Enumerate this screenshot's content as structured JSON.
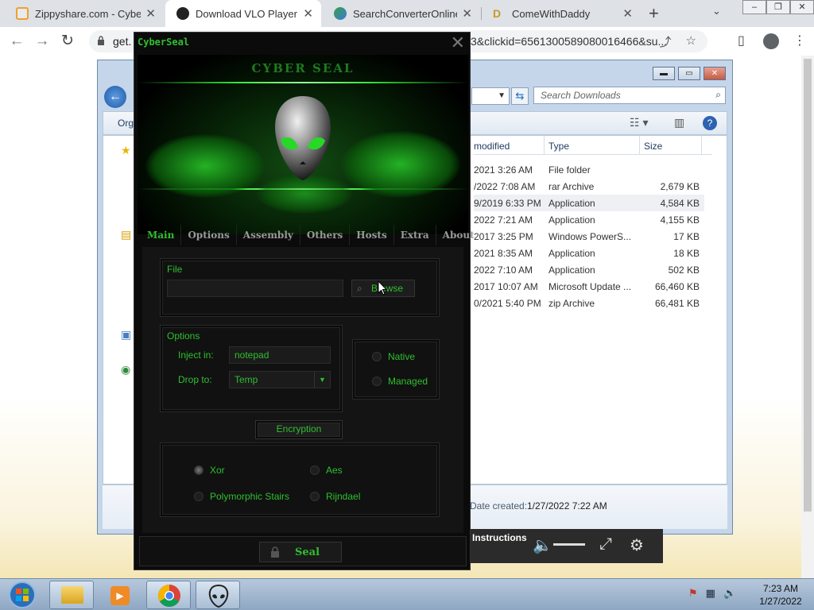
{
  "browser": {
    "tabs": [
      {
        "title": "Zippyshare.com - CyberS",
        "active": false
      },
      {
        "title": "Download VLO Player",
        "active": true
      },
      {
        "title": "SearchConverterOnline",
        "active": false
      },
      {
        "title": "ComeWithDaddy",
        "active": false
      }
    ],
    "url_prefix": "get.",
    "url_suffix": "3&clickid=6561300589080016466&su..."
  },
  "explorer": {
    "search_placeholder": "Search Downloads",
    "organize_label": "Org",
    "columns": {
      "modified": "modified",
      "type": "Type",
      "size": "Size"
    },
    "files": [
      {
        "modified": "2021 3:26 AM",
        "type": "File folder",
        "size": ""
      },
      {
        "modified": "/2022 7:08 AM",
        "type": "rar Archive",
        "size": "2,679 KB"
      },
      {
        "modified": "9/2019 6:33 PM",
        "type": "Application",
        "size": "4,584 KB"
      },
      {
        "modified": "2022 7:21 AM",
        "type": "Application",
        "size": "4,155 KB"
      },
      {
        "modified": "2017 3:25 PM",
        "type": "Windows PowerS...",
        "size": "17 KB"
      },
      {
        "modified": "2021 8:35 AM",
        "type": "Application",
        "size": "18 KB"
      },
      {
        "modified": "2022 7:10 AM",
        "type": "Application",
        "size": "502 KB"
      },
      {
        "modified": "2017 10:07 AM",
        "type": "Microsoft Update ...",
        "size": "66,460 KB"
      },
      {
        "modified": "0/2021 5:40 PM",
        "type": "zip Archive",
        "size": "66,481 KB"
      }
    ],
    "details_label": "Date created:",
    "details_value": "1/27/2022 7:22 AM"
  },
  "video": {
    "instructions": "Instructions"
  },
  "cyberseal": {
    "window_title": "CyberSeal",
    "banner_title": "CYBER SEAL",
    "tabs": [
      "Main",
      "Options",
      "Assembly",
      "Others",
      "Hosts",
      "Extra",
      "About"
    ],
    "active_tab": "Main",
    "file_group": "File",
    "file_path": "",
    "browse_label": "Browse",
    "options_group": "Options",
    "inject_label": "Inject in:",
    "inject_value": "notepad",
    "drop_label": "Drop to:",
    "drop_value": "Temp",
    "native_label": "Native",
    "managed_label": "Managed",
    "encryption_label": "Encryption",
    "enc": {
      "xor": "Xor",
      "aes": "Aes",
      "poly": "Polymorphic Stairs",
      "rijndael": "Rijndael"
    },
    "seal_label": "Seal"
  },
  "taskbar": {
    "time": "7:23 AM",
    "date": "1/27/2022"
  },
  "colors": {
    "accent_green": "#2fbf2f",
    "window_bg": "#0b0b0b"
  }
}
